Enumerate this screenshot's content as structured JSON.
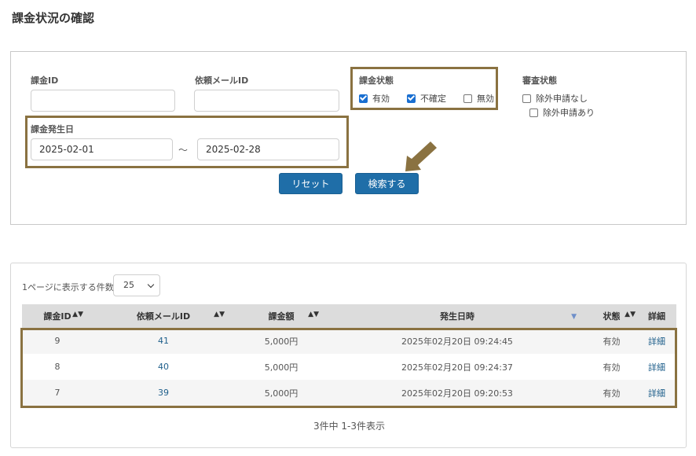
{
  "page_title": "課金状況の確認",
  "search": {
    "charge_id_label": "課金ID",
    "charge_id_value": "",
    "request_mail_id_label": "依頼メールID",
    "request_mail_id_value": "",
    "charge_status_label": "課金状態",
    "charge_status_options": [
      {
        "label": "有効",
        "checked": true
      },
      {
        "label": "不確定",
        "checked": true
      },
      {
        "label": "無効",
        "checked": false
      }
    ],
    "review_status_label": "審査状態",
    "review_status_options": [
      {
        "label": "除外申請なし",
        "checked": false
      },
      {
        "label": "除外申請あり",
        "checked": false
      }
    ],
    "date_label": "課金発生日",
    "date_from": "2025-02-01",
    "date_separator": "～",
    "date_to": "2025-02-28",
    "reset_label": "リセット",
    "search_label": "検索する"
  },
  "results": {
    "per_page_label": "1ページに表示する件数",
    "per_page_value": "25",
    "columns": [
      "課金ID",
      "依頼メールID",
      "課金額",
      "発生日時",
      "状態",
      "詳細"
    ],
    "rows": [
      {
        "charge_id": "9",
        "mail_id": "41",
        "amount": "5,000円",
        "datetime": "2025年02月20日 09:24:45",
        "status": "有効",
        "detail": "詳細"
      },
      {
        "charge_id": "8",
        "mail_id": "40",
        "amount": "5,000円",
        "datetime": "2025年02月20日 09:24:37",
        "status": "有効",
        "detail": "詳細"
      },
      {
        "charge_id": "7",
        "mail_id": "39",
        "amount": "5,000円",
        "datetime": "2025年02月20日 09:20:53",
        "status": "有効",
        "detail": "詳細"
      }
    ],
    "count_text": "3件中 1-3件表示"
  },
  "colors": {
    "highlight": "#8a7241",
    "button": "#1f6ea8",
    "link": "#1f5f8b"
  }
}
